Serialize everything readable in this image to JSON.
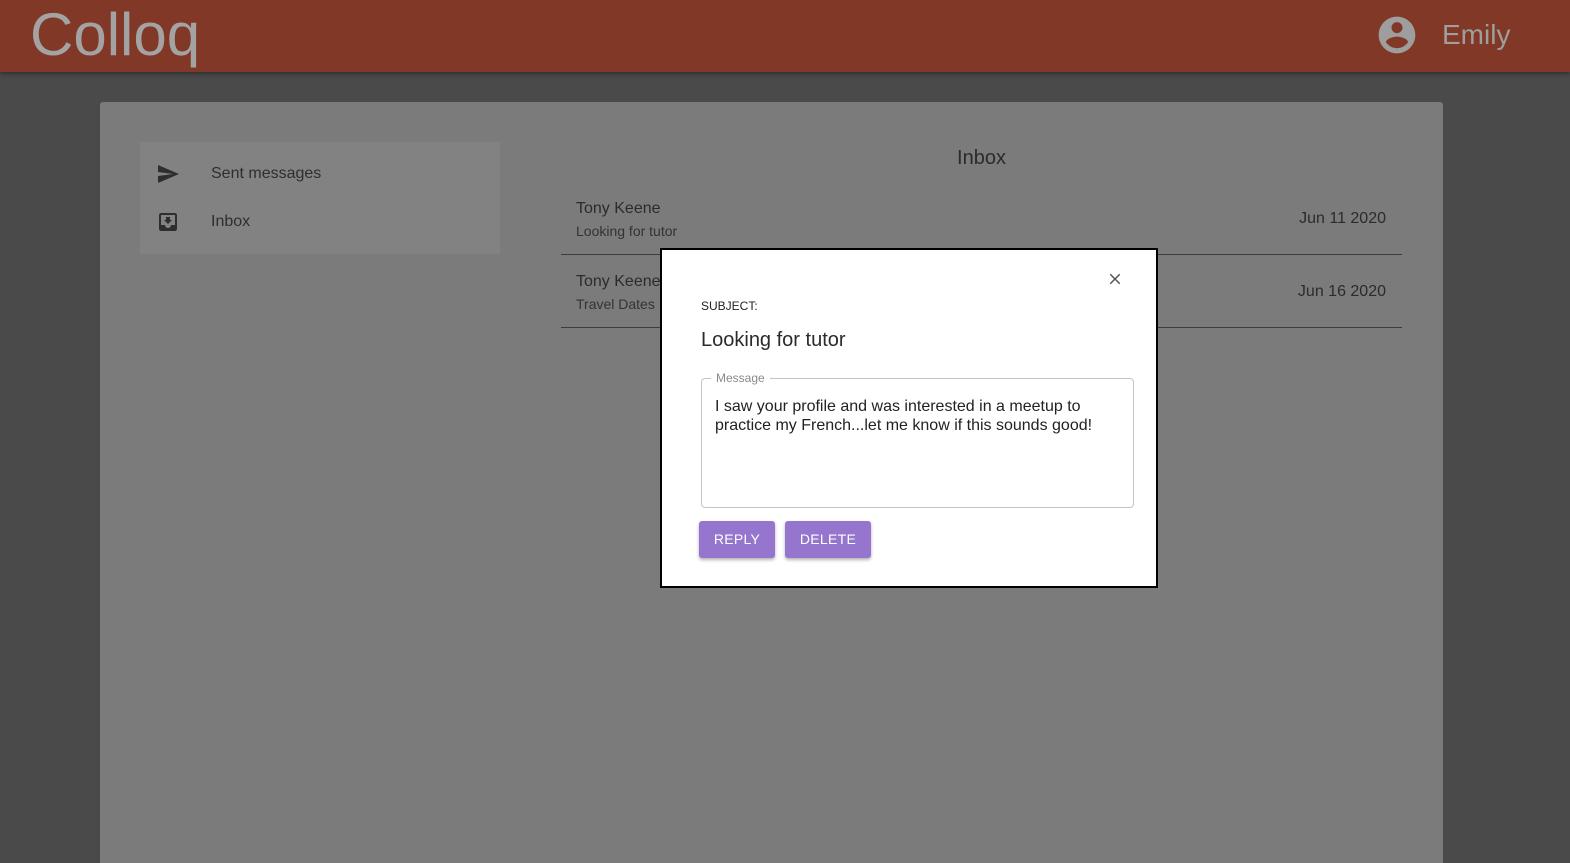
{
  "app": {
    "logo": "Colloq",
    "username": "Emily"
  },
  "icons": {
    "account": "account-circle-icon",
    "sent": "send-icon",
    "inbox": "inbox-icon",
    "close": "close-icon"
  },
  "colors": {
    "header": "#823826",
    "accent": "#9575cd"
  },
  "sidebar": {
    "items": [
      {
        "label": "Sent messages"
      },
      {
        "label": "Inbox"
      }
    ]
  },
  "inbox": {
    "title": "Inbox",
    "messages": [
      {
        "from": "Tony Keene",
        "subject": "Looking for tutor",
        "date": "Jun 11 2020"
      },
      {
        "from": "Tony Keene",
        "subject": "Travel Dates",
        "date": "Jun 16 2020"
      }
    ]
  },
  "modal": {
    "subject_label": "SUBJECT:",
    "subject": "Looking for tutor",
    "message_label": "Message",
    "message": "I saw your profile and was interested in a meetup to practice my French...let me know if this sounds good!",
    "reply_label": "REPLY",
    "delete_label": "DELETE"
  }
}
